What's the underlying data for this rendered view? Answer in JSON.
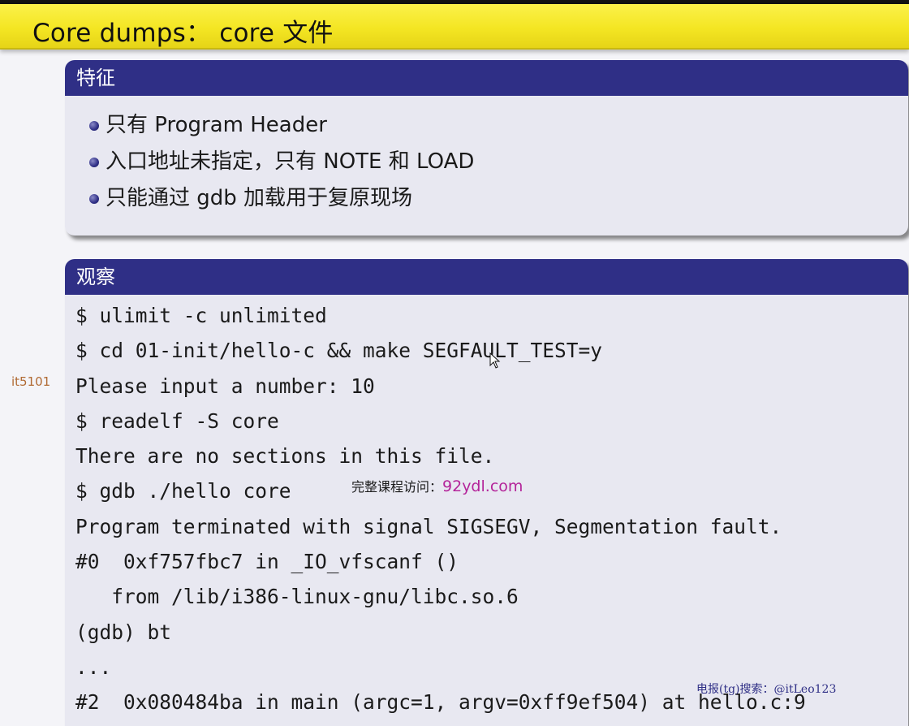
{
  "slide": {
    "title": "Core dumps： core 文件",
    "side_label": "it5101"
  },
  "block_features": {
    "header": "特征",
    "items": [
      "只有 Program Header",
      "入口地址未指定，只有 NOTE 和 LOAD",
      "只能通过 gdb 加载用于复原现场"
    ]
  },
  "block_observe": {
    "header": "观察",
    "lines": [
      "$ ulimit -c unlimited",
      "$ cd 01-init/hello-c && make SEGFAULT_TEST=y",
      "Please input a number: 10",
      "$ readelf -S core",
      "There are no sections in this file.",
      "$ gdb ./hello core",
      "Program terminated with signal SIGSEGV, Segmentation fault.",
      "#0  0xf757fbc7 in _IO_vfscanf ()",
      "   from /lib/i386-linux-gnu/libc.so.6",
      "(gdb) bt",
      "...",
      "#2  0x080484ba in main (argc=1, argv=0xff9ef504) at hello.c:9"
    ]
  },
  "watermarks": {
    "course_label": "完整课程访问：",
    "course_url": "92ydl.com",
    "tg": "电报(tg)搜索：@itLeo123"
  },
  "colors": {
    "title_bar": "#f4e623",
    "block_header": "#2f2f86",
    "block_body": "#e8e8f1",
    "url": "#b4249a"
  },
  "icons": [
    "mouse-cursor-icon",
    "bullet-icon"
  ]
}
